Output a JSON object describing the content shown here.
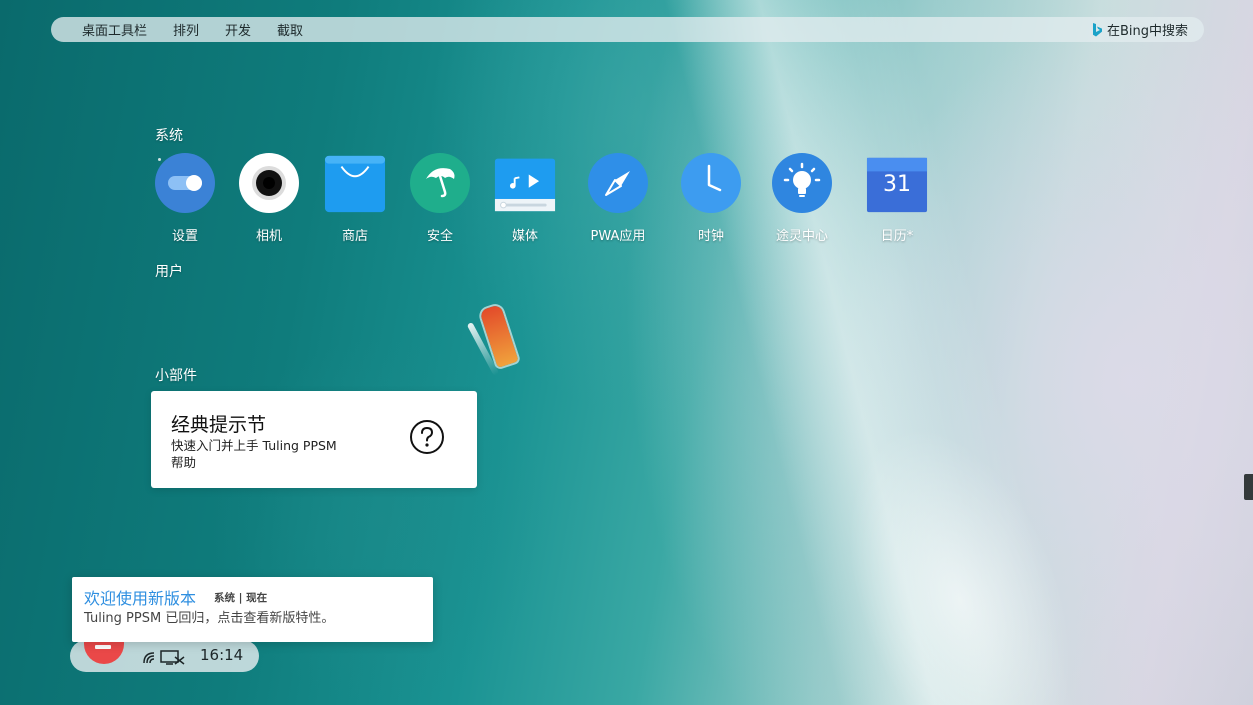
{
  "toolbar": {
    "menu": [
      {
        "label": "桌面工具栏"
      },
      {
        "label": "排列"
      },
      {
        "label": "开发"
      },
      {
        "label": "截取"
      }
    ],
    "search_label": "在Bing中搜索"
  },
  "sections": {
    "system": "系统",
    "user": "用户",
    "widgets": "小部件"
  },
  "apps": [
    {
      "label": "设置",
      "icon": "toggle-icon",
      "color": "#3b82d6"
    },
    {
      "label": "相机",
      "icon": "camera-lens-icon",
      "color": "#ffffff"
    },
    {
      "label": "商店",
      "icon": "shopping-bag-icon",
      "color": "#1e9cf0"
    },
    {
      "label": "安全",
      "icon": "umbrella-icon",
      "color": "#1fae8c"
    },
    {
      "label": "媒体",
      "icon": "media-player-icon",
      "color": "#1e9cf0"
    },
    {
      "label": "PWA应用",
      "icon": "compass-icon",
      "color": "#2f8fe8"
    },
    {
      "label": "时钟",
      "icon": "clock-icon",
      "color": "#3d9cf0"
    },
    {
      "label": "途灵中心",
      "icon": "lightbulb-icon",
      "color": "#2f86e0"
    },
    {
      "label": "日历*",
      "icon": "calendar-icon",
      "color": "#3a6ed8",
      "day": "31"
    }
  ],
  "widget": {
    "title": "经典提示节",
    "subtitle": "快速入门并上手 Tuling PPSM",
    "link": "帮助"
  },
  "notification": {
    "title": "欢迎使用新版本",
    "meta": "系统 | 现在",
    "body": "Tuling PPSM 已回归，点击查看新版特性。"
  },
  "taskbar": {
    "time": "16:14"
  }
}
